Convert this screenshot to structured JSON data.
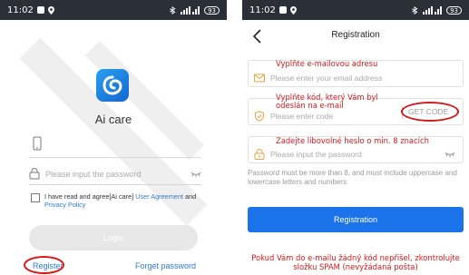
{
  "status_bar": {
    "time": "11:02",
    "battery": "93"
  },
  "login": {
    "app_name": "Ai care",
    "password_placeholder": "Please input the password",
    "agreement_prefix": "I have read and agree[Ai care] ",
    "user_agreement": "User Agreement",
    "and": " and ",
    "privacy_policy": "Privacy Policy",
    "login_button": "Login",
    "register_link": "Register",
    "forgot_link": "Forget password"
  },
  "registration": {
    "title": "Registration",
    "email_placeholder": "Please enter your email address",
    "code_placeholder": "Please enter code",
    "get_code": "GET CODE",
    "password_placeholder": "Please input the password",
    "password_hint": "Password must be more than 8, and must include uppercase and lowercase letters and numbers",
    "register_button": "Registration"
  },
  "annotations": {
    "email": "Vyplňte e-mailovou adresu",
    "code": "Vyplňte kód, který Vám byl odeslán na e-mail",
    "password": "Zadejte libovolné heslo o min. 8 znacích",
    "bottom": "Pokud Vám do e-mailu žádný kód nepřišel, zkontrolujte složku SPAM (nevyžádaná pošta)"
  },
  "colors": {
    "annotation_red": "#d41818",
    "link_blue": "#2f7ad6",
    "primary_blue": "#1a73e8",
    "status_bar": "#2b3038"
  }
}
